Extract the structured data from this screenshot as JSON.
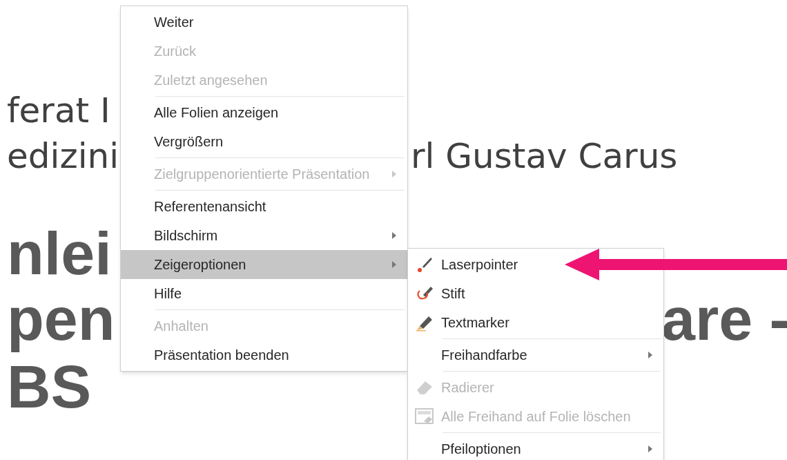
{
  "slide": {
    "lines": [
      {
        "kind": "subtitle",
        "left": "ferat I"
      },
      {
        "kind": "subtitle",
        "left": "edizini",
        "right": "rl Gustav Carus"
      },
      {
        "kind": "title",
        "left": "nlei"
      },
      {
        "kind": "title",
        "left": "pen",
        "right": "are -"
      },
      {
        "kind": "title",
        "left": "BS"
      }
    ]
  },
  "context_menu": {
    "items": [
      {
        "kind": "item",
        "label": "Weiter",
        "disabled": false,
        "selected": false,
        "submenu": false
      },
      {
        "kind": "item",
        "label": "Zurück",
        "disabled": true,
        "selected": false,
        "submenu": false
      },
      {
        "kind": "item",
        "label": "Zuletzt angesehen",
        "disabled": true,
        "selected": false,
        "submenu": false
      },
      {
        "kind": "separator"
      },
      {
        "kind": "item",
        "label": "Alle Folien anzeigen",
        "disabled": false,
        "selected": false,
        "submenu": false
      },
      {
        "kind": "item",
        "label": "Vergrößern",
        "disabled": false,
        "selected": false,
        "submenu": false
      },
      {
        "kind": "separator"
      },
      {
        "kind": "item",
        "label": "Zielgruppenorientierte Präsentation",
        "disabled": true,
        "selected": false,
        "submenu": true
      },
      {
        "kind": "separator"
      },
      {
        "kind": "item",
        "label": "Referentenansicht",
        "disabled": false,
        "selected": false,
        "submenu": false
      },
      {
        "kind": "item",
        "label": "Bildschirm",
        "disabled": false,
        "selected": false,
        "submenu": true
      },
      {
        "kind": "item",
        "label": "Zeigeroptionen",
        "disabled": false,
        "selected": true,
        "submenu": true
      },
      {
        "kind": "item",
        "label": "Hilfe",
        "disabled": false,
        "selected": false,
        "submenu": false
      },
      {
        "kind": "separator"
      },
      {
        "kind": "item",
        "label": "Anhalten",
        "disabled": true,
        "selected": false,
        "submenu": false
      },
      {
        "kind": "item",
        "label": "Präsentation beenden",
        "disabled": false,
        "selected": false,
        "submenu": false
      }
    ]
  },
  "submenu": {
    "items": [
      {
        "kind": "laser",
        "label": "Laserpointer",
        "disabled": false
      },
      {
        "kind": "pen",
        "label": "Stift",
        "disabled": false,
        "submenu": false
      },
      {
        "kind": "highlighter",
        "label": "Textmarker",
        "disabled": false,
        "submenu": false
      },
      {
        "kind": "separator"
      },
      {
        "kind": "plain",
        "label": "Freihandfarbe",
        "disabled": false,
        "submenu": true
      },
      {
        "kind": "separator"
      },
      {
        "kind": "eraser",
        "label": "Radierer",
        "disabled": true,
        "submenu": false
      },
      {
        "kind": "clear",
        "label": "Alle Freihand auf Folie löschen",
        "disabled": true,
        "submenu": false
      },
      {
        "kind": "separator"
      },
      {
        "kind": "plain",
        "label": "Pfeiloptionen",
        "disabled": false,
        "submenu": true
      }
    ]
  }
}
